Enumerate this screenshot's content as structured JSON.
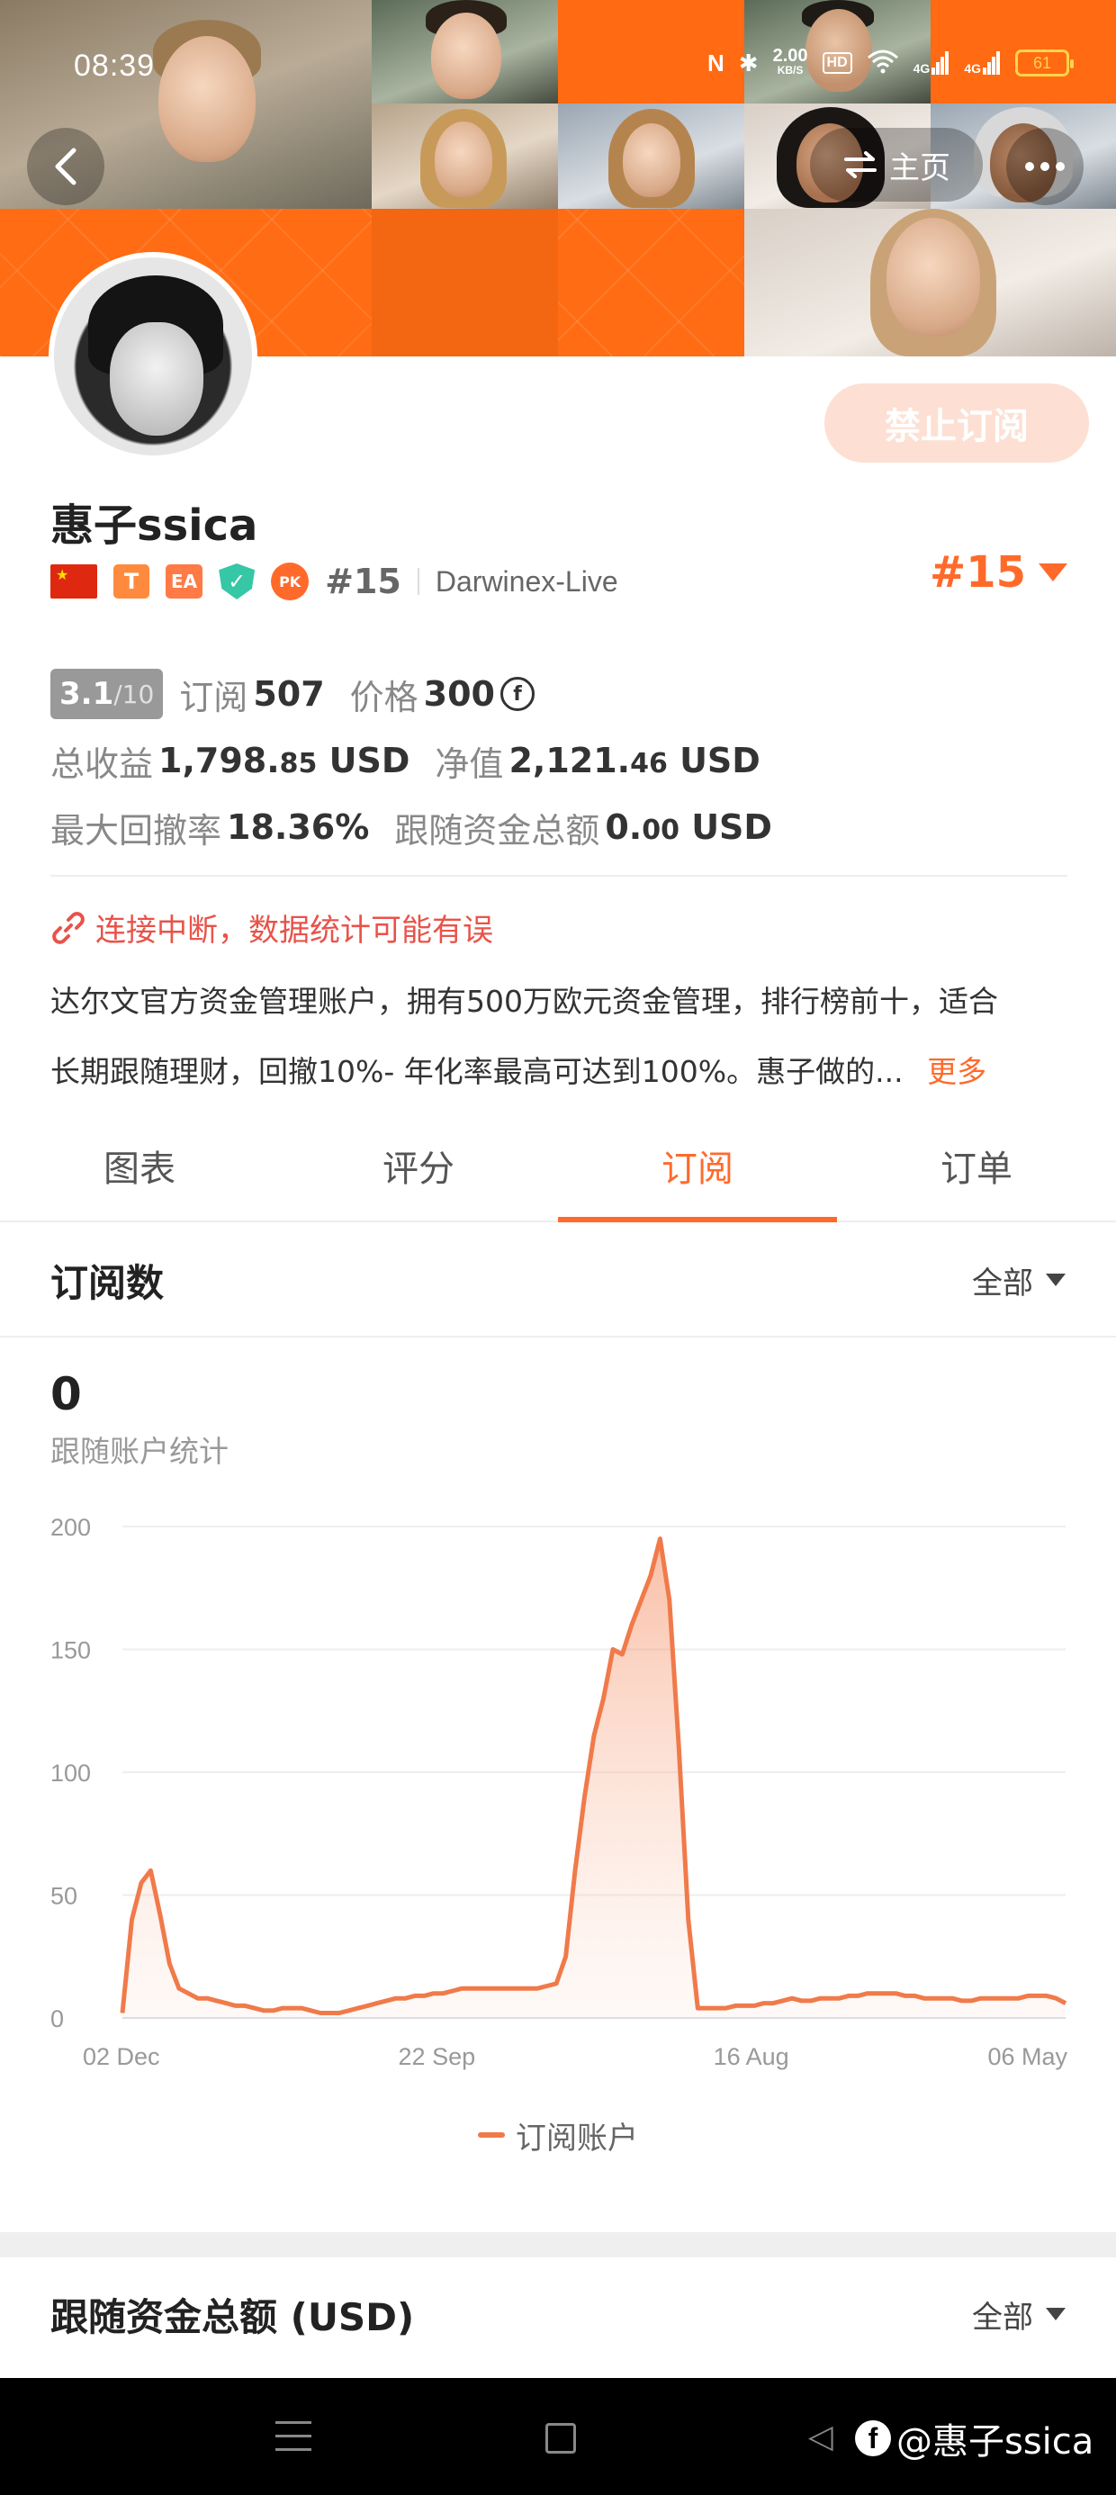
{
  "status_bar": {
    "time": "08:39",
    "net_speed_value": "2.00",
    "net_speed_unit": "KB/S",
    "hd_label": "HD",
    "signal1_label": "4G",
    "signal2_label": "4G",
    "battery": "61"
  },
  "header": {
    "home_label": "主页"
  },
  "profile": {
    "subscribe_button": "禁止订阅",
    "name": "惠子ssica",
    "badge_t": "T",
    "badge_ea": "EA",
    "badge_pk": "PK",
    "rank_small": "#15",
    "broker": "Darwinex-Live",
    "rank_big": "#15"
  },
  "stats": {
    "score": "3.1",
    "score_max": "/10",
    "subscribe_label": "订阅",
    "subscribe_count": "507",
    "price_label": "价格",
    "price_value": "300",
    "price_coin": "f",
    "total_profit_label": "总收益",
    "total_profit_main": "1,798.",
    "total_profit_decimal": "85",
    "total_profit_unit": "USD",
    "net_value_label": "净值",
    "net_value_main": "2,121.",
    "net_value_decimal": "46",
    "net_value_unit": "USD",
    "max_drawdown_label": "最大回撤率",
    "max_drawdown_value": "18.36%",
    "follow_funds_label": "跟随资金总额",
    "follow_funds_main": "0.",
    "follow_funds_decimal": "00",
    "follow_funds_unit": "USD"
  },
  "warning": "连接中断，数据统计可能有误",
  "description": {
    "line1": "达尔文官方资金管理账户，拥有500万欧元资金管理，排行榜前十，适合",
    "line2": "长期跟随理财，回撤10%- 年化率最高可达到100%。惠子做的...",
    "more": "更多"
  },
  "tabs": [
    {
      "label": "图表",
      "active": false
    },
    {
      "label": "评分",
      "active": false
    },
    {
      "label": "订阅",
      "active": true
    },
    {
      "label": "订单",
      "active": false
    }
  ],
  "section_subscriptions": {
    "title": "订阅数",
    "filter": "全部",
    "count": "0",
    "count_label": "跟随账户统计"
  },
  "section_follow_funds": {
    "title": "跟随资金总额 (USD)",
    "filter": "全部"
  },
  "nav": {
    "watermark_text": "@惠子ssica"
  },
  "colors": {
    "accent": "#ff6a2b",
    "line": "#f07a4a",
    "grid": "#eeeeee"
  },
  "chart_data": {
    "type": "area",
    "ylim": [
      0,
      200
    ],
    "y_ticks": [
      "0",
      "50",
      "100",
      "150",
      "200"
    ],
    "x_tick_labels": [
      "02 Dec",
      "22 Sep",
      "16 Aug",
      "06 May"
    ],
    "legend": [
      "订阅账户"
    ],
    "grid": true,
    "series": [
      {
        "name": "订阅账户",
        "x": [
          0,
          1,
          2,
          3,
          4,
          5,
          6,
          7,
          8,
          9,
          10,
          11,
          12,
          13,
          14,
          15,
          16,
          17,
          18,
          19,
          20,
          21,
          22,
          23,
          24,
          25,
          26,
          27,
          28,
          29,
          30,
          31,
          32,
          33,
          34,
          35,
          36,
          37,
          38,
          39,
          40,
          41,
          42,
          43,
          44,
          45,
          46,
          47,
          48,
          49,
          50,
          51,
          52,
          53,
          54,
          55,
          56,
          57,
          58,
          59,
          60,
          61,
          62,
          63,
          64,
          65,
          66,
          67,
          68,
          69,
          70,
          71,
          72,
          73,
          74,
          75,
          76,
          77,
          78,
          79,
          80,
          81,
          82,
          83,
          84,
          85,
          86,
          87,
          88,
          89,
          90,
          91,
          92,
          93,
          94,
          95,
          96,
          97,
          98,
          99,
          100
        ],
        "values": [
          2,
          40,
          55,
          60,
          42,
          22,
          12,
          10,
          8,
          8,
          7,
          6,
          5,
          5,
          4,
          3,
          3,
          4,
          4,
          4,
          3,
          2,
          2,
          2,
          3,
          4,
          5,
          6,
          7,
          8,
          8,
          9,
          9,
          10,
          10,
          11,
          12,
          12,
          12,
          12,
          12,
          12,
          12,
          12,
          12,
          13,
          14,
          25,
          60,
          90,
          115,
          130,
          150,
          148,
          160,
          170,
          180,
          195,
          170,
          110,
          40,
          4,
          4,
          4,
          4,
          5,
          5,
          5,
          6,
          6,
          7,
          8,
          7,
          7,
          8,
          8,
          8,
          9,
          9,
          10,
          10,
          10,
          10,
          9,
          9,
          8,
          8,
          8,
          8,
          7,
          7,
          8,
          8,
          8,
          8,
          8,
          9,
          9,
          9,
          8,
          6
        ]
      }
    ]
  }
}
